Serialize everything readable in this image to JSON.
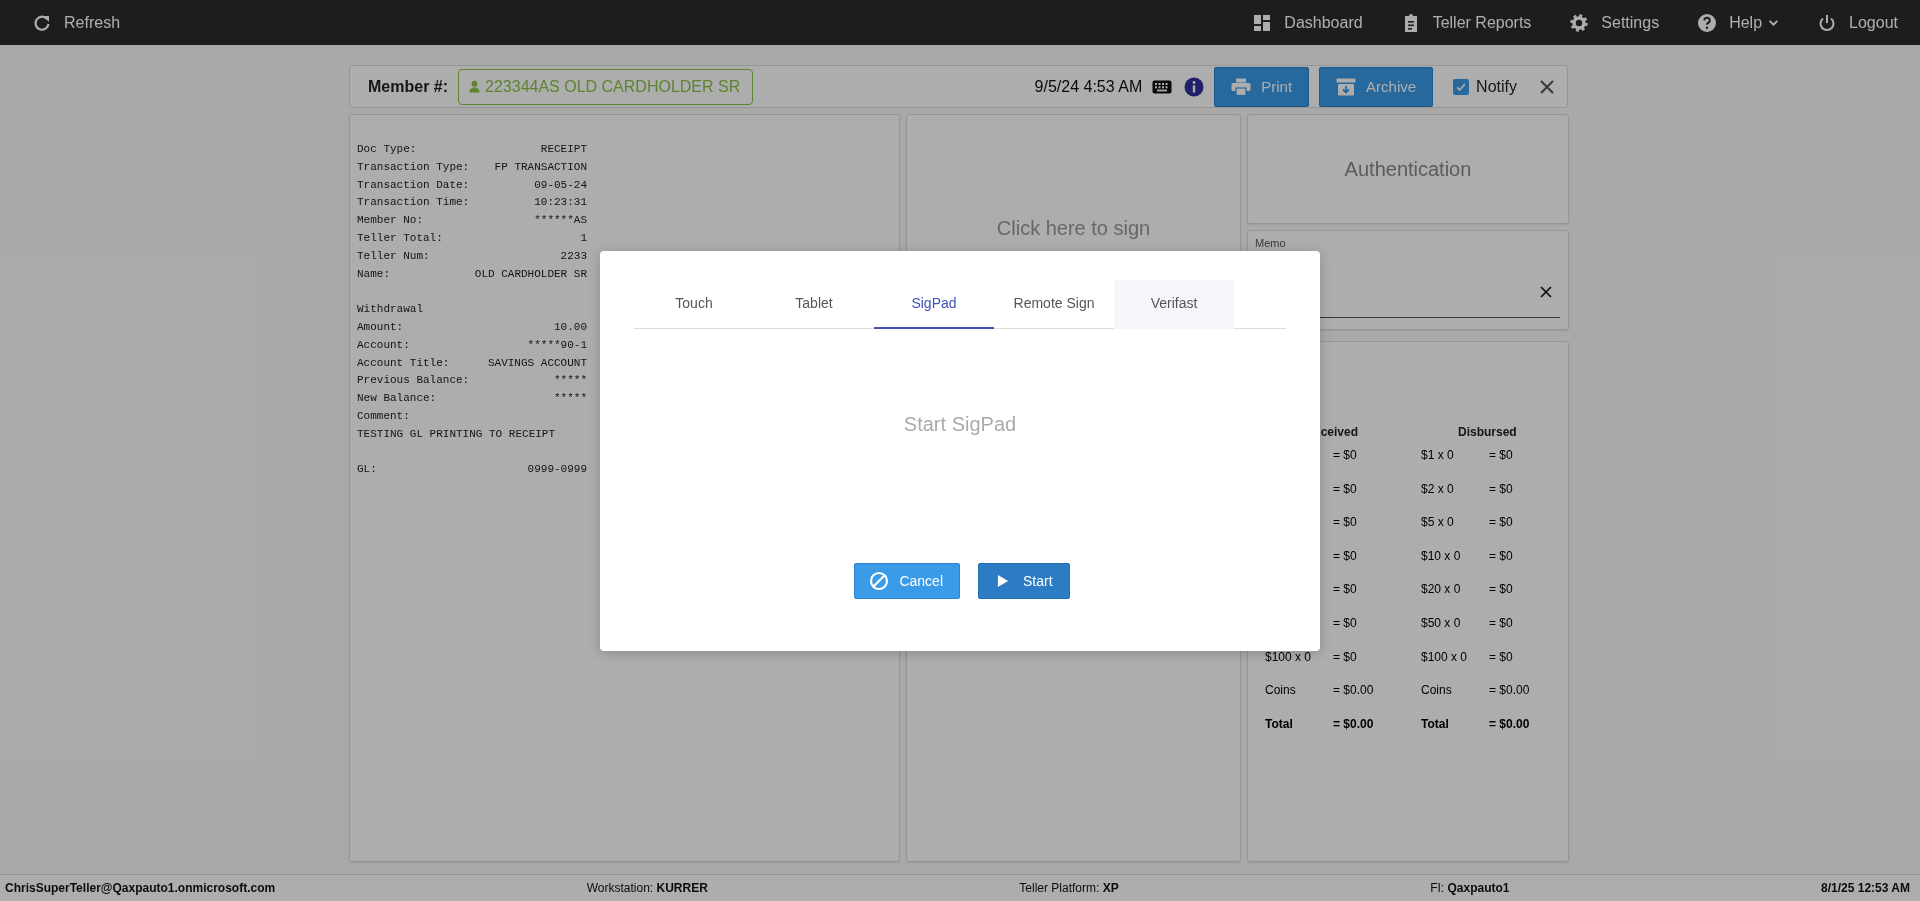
{
  "top_bar": {
    "left": [
      {
        "label": "Refresh",
        "kind": "refresh"
      }
    ],
    "right": [
      {
        "label": "Dashboard",
        "kind": "dashboard",
        "dropdown": false
      },
      {
        "label": "Teller Reports",
        "kind": "reports",
        "dropdown": false
      },
      {
        "label": "Settings",
        "kind": "settings",
        "dropdown": false
      },
      {
        "label": "Help",
        "kind": "help",
        "dropdown": true
      },
      {
        "label": "Logout",
        "kind": "logout",
        "dropdown": false
      }
    ]
  },
  "header": {
    "member_label": "Member #:",
    "member": "223344AS OLD CARDHOLDER SR",
    "datetime": "9/5/24 4:53 AM",
    "buttons": [
      {
        "label": "Print",
        "kind": "print"
      },
      {
        "label": "Archive",
        "kind": "archive"
      }
    ],
    "notify": {
      "label": "Notify",
      "checked": true
    }
  },
  "receipt": {
    "lines": [
      {
        "kind": "pair",
        "label": "Doc Type:",
        "value": "RECEIPT"
      },
      {
        "kind": "pair",
        "label": "Transaction Type:",
        "value": "FP TRANSACTION"
      },
      {
        "kind": "pair",
        "label": "Transaction Date:",
        "value": "09-05-24"
      },
      {
        "kind": "pair",
        "label": "Transaction Time:",
        "value": "10:23:31"
      },
      {
        "kind": "pair",
        "label": "Member No:",
        "value": "******AS"
      },
      {
        "kind": "pair",
        "label": "Teller Total:",
        "value": "1"
      },
      {
        "kind": "pair",
        "label": "Teller Num:",
        "value": "2233"
      },
      {
        "kind": "pair",
        "label": "Name:",
        "value": "OLD CARDHOLDER SR"
      },
      {
        "kind": "blank"
      },
      {
        "kind": "text",
        "label": "Withdrawal"
      },
      {
        "kind": "pair",
        "label": "Amount:",
        "value": "10.00"
      },
      {
        "kind": "pair",
        "label": "Account:",
        "value": "*****90-1"
      },
      {
        "kind": "pair",
        "label": "Account Title:",
        "value": "SAVINGS ACCOUNT"
      },
      {
        "kind": "pair",
        "label": "Previous Balance:",
        "value": "*****"
      },
      {
        "kind": "pair",
        "label": "New Balance:",
        "value": "*****"
      },
      {
        "kind": "text",
        "label": "Comment:"
      },
      {
        "kind": "text",
        "label": "TESTING GL PRINTING TO RECEIPT"
      },
      {
        "kind": "blank"
      },
      {
        "kind": "pair",
        "label": "GL:",
        "value": "0999-0999"
      }
    ]
  },
  "signature": {
    "prompt": "Click here to sign"
  },
  "authentication": {
    "label": "Authentication"
  },
  "memo": {
    "label": "Memo"
  },
  "counts": {
    "received_heading": "ceived",
    "disbursed_heading": "Disbursed",
    "rows": [
      {
        "kind": "line",
        "received_value": "= $0",
        "disbursed_label": "$1 x 0",
        "disbursed_value": "= $0"
      },
      {
        "kind": "line",
        "received_value": "= $0",
        "disbursed_label": "$2 x 0",
        "disbursed_value": "= $0"
      },
      {
        "kind": "line",
        "received_value": "= $0",
        "disbursed_label": "$5 x 0",
        "disbursed_value": "= $0"
      },
      {
        "kind": "line",
        "received_value": "= $0",
        "disbursed_label": "$10 x 0",
        "disbursed_value": "= $0"
      },
      {
        "kind": "line",
        "received_value": "= $0",
        "disbursed_label": "$20 x 0",
        "disbursed_value": "= $0"
      },
      {
        "kind": "line",
        "received_value": "= $0",
        "disbursed_label": "$50 x 0",
        "disbursed_value": "= $0"
      },
      {
        "kind": "line",
        "received_label": "$100 x 0",
        "received_value": "= $0",
        "disbursed_label": "$100 x 0",
        "disbursed_value": "= $0"
      },
      {
        "kind": "line",
        "received_label": "Coins",
        "received_value": "= $0.00",
        "disbursed_label": "Coins",
        "disbursed_value": "= $0.00"
      },
      {
        "kind": "total",
        "received_label": "Total",
        "received_value": "= $0.00",
        "disbursed_label": "Total",
        "disbursed_value": "= $0.00"
      }
    ]
  },
  "modal": {
    "tabs": [
      {
        "label": "Touch",
        "selected": false,
        "highlighted": false
      },
      {
        "label": "Tablet",
        "selected": false,
        "highlighted": false
      },
      {
        "label": "SigPad",
        "selected": true,
        "highlighted": false
      },
      {
        "label": "Remote Sign",
        "selected": false,
        "highlighted": false
      },
      {
        "label": "Verifast",
        "selected": false,
        "highlighted": true
      }
    ],
    "message": "Start SigPad",
    "buttons": [
      {
        "label": "Cancel",
        "kind": "cancel"
      },
      {
        "label": "Start",
        "kind": "start"
      }
    ]
  },
  "status_bar": {
    "user": "ChrisSuperTeller@Qaxpauto1.onmicrosoft.com",
    "workstation": "Workstation: **KURRER**",
    "platform": "Teller Platform: **XP**",
    "fi": "FI: **Qaxpauto1**",
    "datetime": "8/1/25 12:53 AM"
  }
}
